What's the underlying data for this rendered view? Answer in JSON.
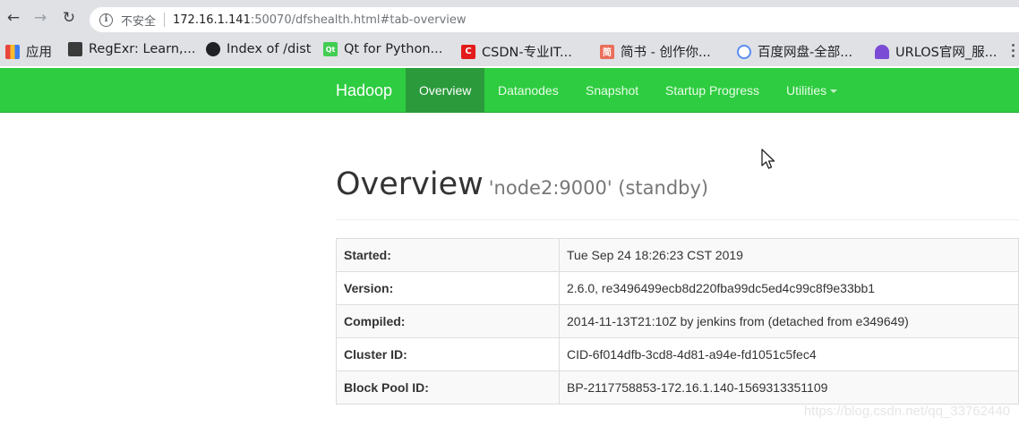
{
  "browser": {
    "not_secure": "不安全",
    "url_host": "172.16.1.141",
    "url_rest": ":50070/dfshealth.html#tab-overview",
    "back_icon": "←",
    "forward_icon": "→",
    "reload_icon": "↻",
    "info_icon": "i"
  },
  "bookmarks": [
    {
      "label": "应用",
      "color": "#e8453c"
    },
    {
      "label": "RegExr: Learn,...",
      "color": "#333333"
    },
    {
      "label": "Index of /dist",
      "color": "#202124"
    },
    {
      "label": "Qt for Python...",
      "color": "#41cd52"
    },
    {
      "label": "CSDN-专业IT...",
      "color": "#e31b1b"
    },
    {
      "label": "简书 - 创作你...",
      "color": "#ea6f5a"
    },
    {
      "label": "百度网盘-全部...",
      "color": "#5b8def"
    },
    {
      "label": "URLOS官网_服...",
      "color": "#7b4bd6"
    }
  ],
  "bookmark_icon_text": [
    "",
    "",
    "",
    "Qt",
    "C",
    "简",
    "",
    ""
  ],
  "navbar": {
    "brand": "Hadoop",
    "items": [
      "Overview",
      "Datanodes",
      "Snapshot",
      "Startup Progress",
      "Utilities"
    ],
    "active": "Overview",
    "color": "#2ecc40"
  },
  "overview": {
    "title": "Overview",
    "subtitle": "'node2:9000' (standby)"
  },
  "info_rows": [
    {
      "key": "Started:",
      "value": "Tue Sep 24 18:26:23 CST 2019"
    },
    {
      "key": "Version:",
      "value": "2.6.0, re3496499ecb8d220fba99dc5ed4c99c8f9e33bb1"
    },
    {
      "key": "Compiled:",
      "value": "2014-11-13T21:10Z by jenkins from (detached from e349649)"
    },
    {
      "key": "Cluster ID:",
      "value": "CID-6f014dfb-3cd8-4d81-a94e-fd1051c5fec4"
    },
    {
      "key": "Block Pool ID:",
      "value": "BP-2117758853-172.16.1.140-1569313351109"
    }
  ],
  "watermark": "https://blog.csdn.net/qq_33762440"
}
